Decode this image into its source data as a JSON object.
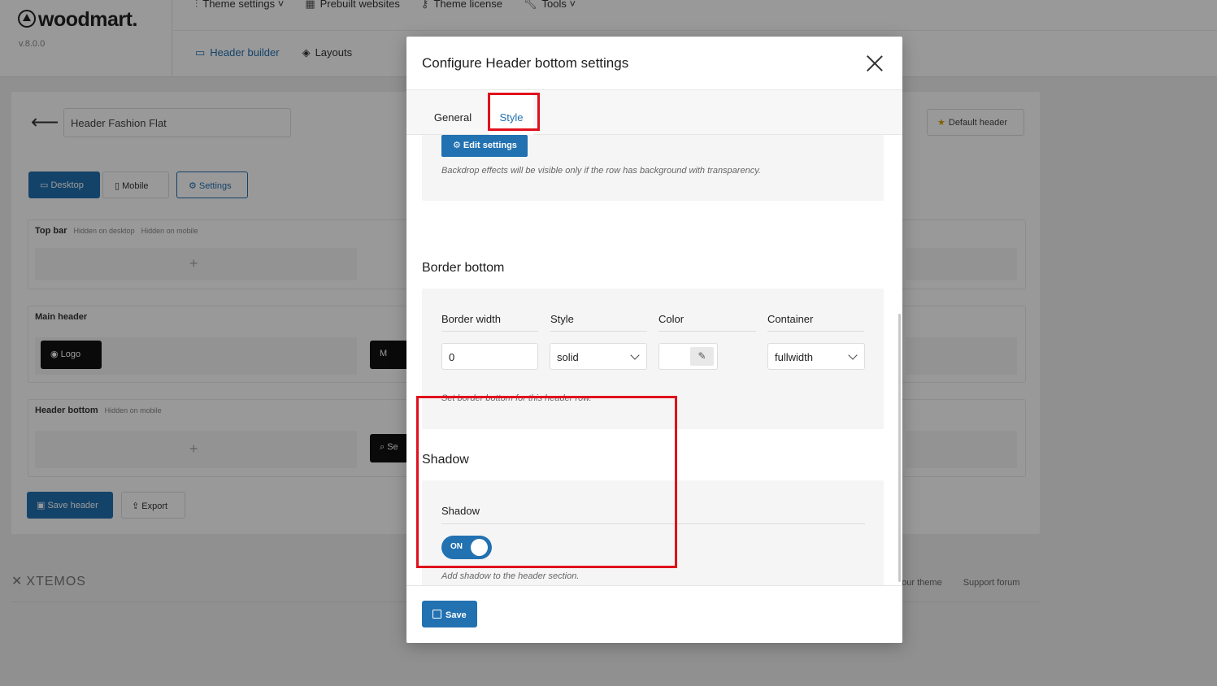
{
  "app": {
    "logo_text": "woodmart.",
    "version": "v.8.0.0",
    "topnav": [
      {
        "label": "Theme settings",
        "icon": "sliders-icon"
      },
      {
        "label": "Prebuilt websites",
        "icon": "grid-icon"
      },
      {
        "label": "Theme license",
        "icon": "key-icon"
      },
      {
        "label": "Tools",
        "icon": "wrench-icon"
      }
    ],
    "subnav": [
      {
        "label": "Header builder",
        "icon": "layout-icon"
      },
      {
        "label": "Layouts",
        "icon": "layers-icon"
      }
    ],
    "header_name": "Header Fashion Flat",
    "default_header": "Default header",
    "device_buttons": {
      "desktop": "Desktop",
      "mobile": "Mobile",
      "settings": "Settings"
    },
    "rows": {
      "top_bar": {
        "title": "Top bar",
        "note_desktop": "Hidden on desktop",
        "note_mobile": "Hidden on mobile"
      },
      "main_header": {
        "title": "Main header",
        "logo": "Logo",
        "element2": "M"
      },
      "header_bottom": {
        "title": "Header bottom",
        "note_mobile": "Hidden on mobile",
        "element2": "Se"
      }
    },
    "save_header": "Save header",
    "export": "Export",
    "brand_footer": "XTEMOS",
    "footer_links": [
      "e our theme",
      "Support forum"
    ],
    "plus": "+"
  },
  "modal": {
    "title": "Configure Header bottom settings",
    "tabs": {
      "general": "General",
      "style": "Style"
    },
    "backdrop": {
      "button": "Edit settings",
      "hint": "Backdrop effects will be visible only if the row has background with transparency."
    },
    "border_bottom": {
      "title": "Border bottom",
      "labels": {
        "width": "Border width",
        "style": "Style",
        "color": "Color",
        "container": "Container"
      },
      "values": {
        "width": "0",
        "style": "solid",
        "container": "fullwidth"
      },
      "hint": "Set border bottom for this header row."
    },
    "shadow": {
      "title": "Shadow",
      "label": "Shadow",
      "toggle": "ON",
      "hint": "Add shadow to the header section."
    },
    "save": "Save"
  },
  "colors": {
    "accent": "#2271b1",
    "highlight": "#e0101d"
  }
}
